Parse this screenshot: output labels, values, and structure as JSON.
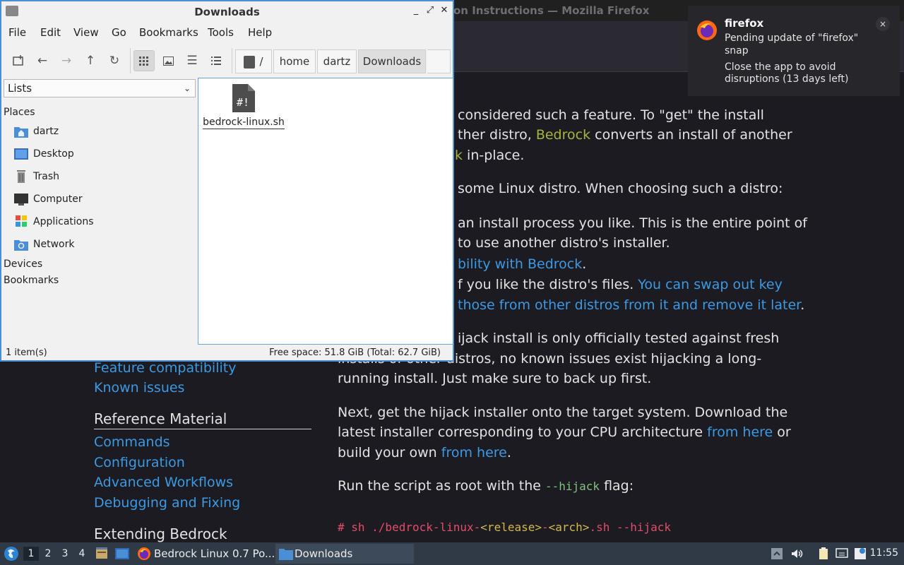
{
  "firefox": {
    "title": "on Instructions — Mozilla Firefox",
    "content": {
      "lines": [
        {
          "text": "considered such a feature. To \"get\" the install"
        },
        {
          "prefix": "ther distro, ",
          "link": "Bedrock",
          "suffix": " converts an install of another"
        },
        {
          "link": "k",
          "suffix": " in-place."
        },
        {
          "text": "some Linux distro. When choosing such a distro:"
        },
        {
          "text": "an install process you like. This is the entire point of"
        },
        {
          "text": "to use another distro's installer."
        },
        {
          "link": "bility with Bedrock",
          "suffix": "."
        },
        {
          "prefix": "f you like the distro's files. ",
          "link": "You can swap out key"
        },
        {
          "link": "those from other distros from it and remove it later",
          "suffix": "."
        },
        {
          "text": "ijack install is only officially tested against fresh"
        },
        {
          "text": "installs of other distros, no known issues exist hijacking a long-"
        },
        {
          "text": "running install. Just make sure to back up first."
        },
        {
          "text": "Next, get the hijack installer onto the target system. Download the"
        },
        {
          "prefix": "latest installer corresponding to your CPU architecture ",
          "link": "from here",
          "suffix": " or"
        },
        {
          "prefix": "build your own ",
          "link": "from here",
          "suffix": "."
        },
        {
          "prefix": "Run the script as root with the ",
          "code": "--hijack",
          "suffix": " flag:"
        }
      ],
      "command": {
        "prefix": "# sh ./bedrock-linux-",
        "release": "<release>",
        "mid": "-",
        "arch": "<arch>",
        "suffix": ".sh --hijack"
      }
    },
    "sidebar": {
      "links_top": [
        "Feature compatibility",
        "Known issues"
      ],
      "reference_heading": "Reference Material",
      "reference_links": [
        "Commands",
        "Configuration",
        "Advanced Workflows",
        "Debugging and Fixing"
      ],
      "extending_heading": "Extending Bedrock"
    }
  },
  "notification": {
    "app": "firefox",
    "line1": "Pending update of \"firefox\"",
    "line2": "snap",
    "line3": "Close the app to avoid",
    "line4": "disruptions (13 days left)",
    "close": "×"
  },
  "file_manager": {
    "title": "Downloads",
    "window_buttons": {
      "minimize": "_",
      "maximize": "⤢",
      "close": "✕"
    },
    "menu": [
      "File",
      "Edit",
      "View",
      "Go",
      "Bookmarks",
      "Tools",
      "Help"
    ],
    "path": {
      "root": "/",
      "crumbs": [
        "home",
        "dartz",
        "Downloads"
      ]
    },
    "places_combo": "Lists",
    "sections": {
      "places": "Places",
      "devices": "Devices",
      "bookmarks": "Bookmarks"
    },
    "places": [
      {
        "label": "dartz",
        "icon": "home-folder-icon"
      },
      {
        "label": "Desktop",
        "icon": "desktop-icon"
      },
      {
        "label": "Trash",
        "icon": "trash-icon"
      },
      {
        "label": "Computer",
        "icon": "computer-icon"
      },
      {
        "label": "Applications",
        "icon": "applications-icon"
      },
      {
        "label": "Network",
        "icon": "network-icon"
      }
    ],
    "files": [
      {
        "name": "bedrock-linux.sh",
        "icon": "shell-script-icon"
      }
    ],
    "status": {
      "count": "1 item(s)",
      "free_space": "Free space: 51.8 GiB (Total: 62.7 GiB)"
    }
  },
  "taskbar": {
    "workspaces": [
      "1",
      "2",
      "3",
      "4"
    ],
    "active_workspace": "1",
    "tasks": [
      {
        "label": "Bedrock Linux 0.7 Po...",
        "icon": "firefox-icon"
      },
      {
        "label": "Downloads",
        "icon": "folder-icon"
      }
    ],
    "clock": "11:55"
  },
  "colors": {
    "accent": "#4a8fd6",
    "link": "#3b9ae3",
    "bedrock_green": "#a8b43a",
    "taskbar": "#2f3a46"
  }
}
